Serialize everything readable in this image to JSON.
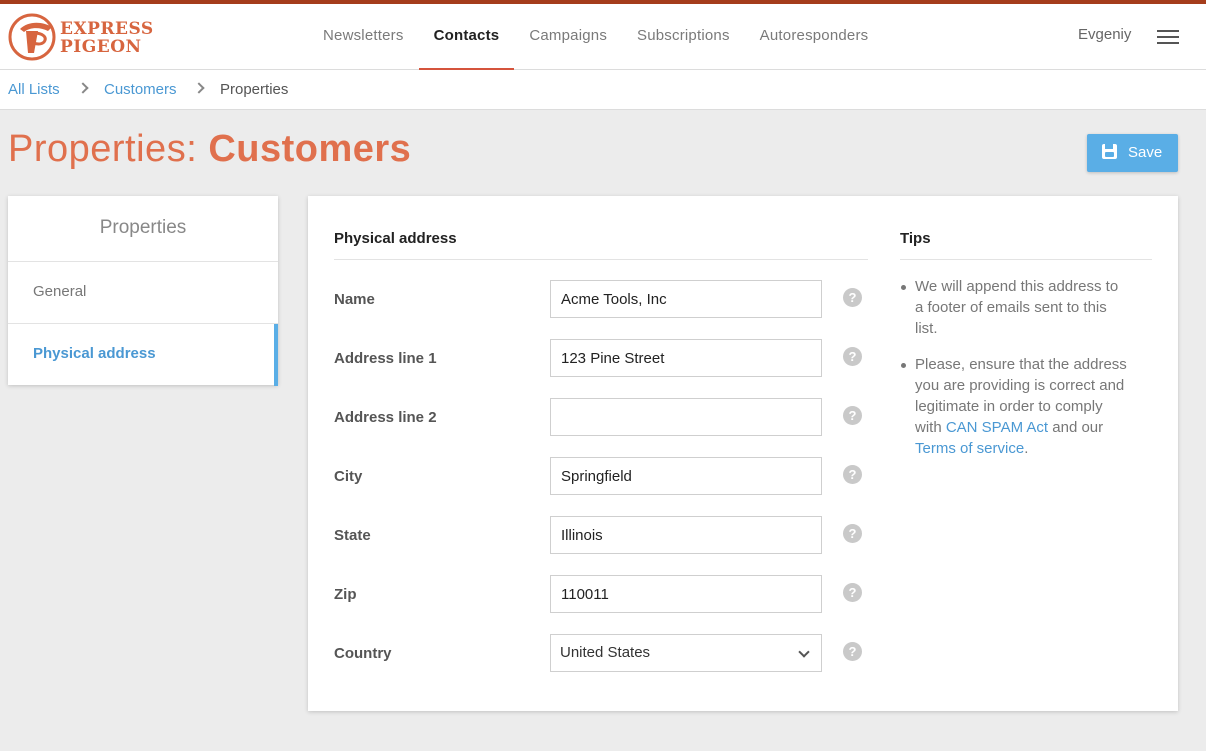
{
  "header": {
    "logo_line1": "EXPRESS",
    "logo_line2": "PIGEON",
    "nav": [
      {
        "label": "Newsletters"
      },
      {
        "label": "Contacts"
      },
      {
        "label": "Campaigns"
      },
      {
        "label": "Subscriptions"
      },
      {
        "label": "Autoresponders"
      }
    ],
    "active_nav": "Contacts",
    "user_name": "Evgeniy",
    "menu_icon": "hamburger-icon"
  },
  "breadcrumb": {
    "items": [
      "All Lists",
      "Customers",
      "Properties"
    ]
  },
  "page": {
    "title_prefix": "Properties: ",
    "title_name": "Customers",
    "save_label": "Save",
    "save_icon": "floppy-disk-icon"
  },
  "sidebar": {
    "heading": "Properties",
    "items": [
      {
        "label": "General"
      },
      {
        "label": "Physical address"
      }
    ],
    "active_item": "Physical address"
  },
  "form": {
    "section_title": "Physical address",
    "fields": {
      "name": {
        "label": "Name",
        "value": "Acme Tools, Inc"
      },
      "address1": {
        "label": "Address line 1",
        "value": "123 Pine Street"
      },
      "address2": {
        "label": "Address line 2",
        "value": ""
      },
      "city": {
        "label": "City",
        "value": "Springfield"
      },
      "state": {
        "label": "State",
        "value": "Illinois"
      },
      "zip": {
        "label": "Zip",
        "value": "110011"
      },
      "country": {
        "label": "Country",
        "value": "United States"
      }
    },
    "help_glyph": "?"
  },
  "tips": {
    "title": "Tips",
    "tip1": "We will append this address to a footer of emails sent to this list.",
    "tip2_text": "Please, ensure that the address you are providing is correct and legitimate in order to comply with ",
    "tip2_link1": "CAN SPAM Act",
    "tip2_mid": " and our ",
    "tip2_link2": "Terms of service",
    "tip2_end": "."
  },
  "colors": {
    "brand": "#e0704d",
    "top_border": "#a53d1c",
    "link": "#4a98d3",
    "button": "#5aaee6",
    "active_tab_underline": "#d5543c"
  }
}
